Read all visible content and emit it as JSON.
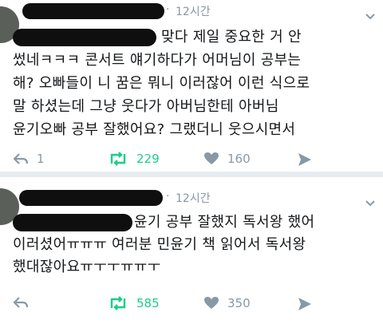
{
  "tweets": [
    {
      "time": "12시간",
      "dot": "·",
      "lines": [
        "맞다 제일 중요한 거 안",
        "썼네ㅋㅋㅋ 콘서트 얘기하다가 어머님이 공부는",
        "해? 오빠들이 니 꿈은 뭐니 이러잖어 이런 식으로",
        "말 하셨는데 그냥 웃다가 아버님한테 아버님",
        "윤기오빠 공부 잘했어요? 그랬더니 웃으시면서"
      ],
      "reply_count": "1",
      "retweet_count": "229",
      "like_count": "160"
    },
    {
      "time": "12시간",
      "dot": "·",
      "lines": [
        "윤기 공부 잘했지 독서왕 했어",
        "이러셨어ㅠㅠㅠ 여러분 민윤기 책 읽어서 독서왕",
        "했대잖아요ㅠㅜㅜㅠㅠㅜ"
      ],
      "reply_count": "",
      "retweet_count": "585",
      "like_count": "350"
    }
  ],
  "colors": {
    "retweet": "#19cf86",
    "muted": "#8899a6",
    "text": "#14171a"
  },
  "icons": [
    "reply-icon",
    "retweet-icon",
    "like-icon",
    "direct-message-icon",
    "chevron-down-icon"
  ]
}
